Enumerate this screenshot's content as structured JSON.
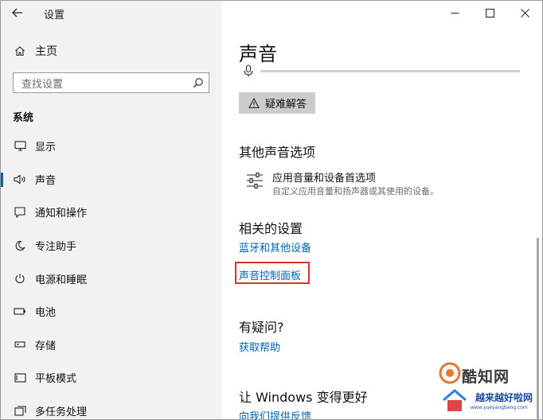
{
  "window": {
    "app_title": "设置",
    "controls": {
      "minimize": "—",
      "maximize": "☐",
      "close": "✕"
    }
  },
  "sidebar": {
    "back_label": "←",
    "home_label": "主页",
    "search_placeholder": "查找设置",
    "section_title": "系统",
    "items": [
      {
        "label": "显示",
        "icon": "monitor-icon"
      },
      {
        "label": "声音",
        "icon": "speaker-icon",
        "active": true
      },
      {
        "label": "通知和操作",
        "icon": "notification-icon"
      },
      {
        "label": "专注助手",
        "icon": "moon-icon"
      },
      {
        "label": "电源和睡眠",
        "icon": "power-icon"
      },
      {
        "label": "电池",
        "icon": "battery-icon"
      },
      {
        "label": "存储",
        "icon": "storage-icon"
      },
      {
        "label": "平板模式",
        "icon": "tablet-icon"
      },
      {
        "label": "多任务处理",
        "icon": "multitask-icon"
      }
    ]
  },
  "main": {
    "title": "声音",
    "troubleshoot_label": "疑难解答",
    "other_sound_options": {
      "header": "其他声音选项",
      "item_title": "应用音量和设备首选项",
      "item_desc": "自定义应用音量和扬声器或其使用的设备。"
    },
    "related_settings": {
      "header": "相关的设置",
      "links": [
        "蓝牙和其他设备",
        "声音控制面板"
      ]
    },
    "questions": {
      "header": "有疑问?",
      "link": "获取帮助"
    },
    "improve": {
      "header": "让 Windows 变得更好",
      "link": "向我们提供反馈"
    }
  },
  "watermark": {
    "brand": "酷知网",
    "site_name": "越来越好啦网",
    "url": "www.yueyangbang.com"
  },
  "colors": {
    "accent": "#0063b1",
    "highlight_border": "#d9332b",
    "sidebar_bg": "#f2f2f2",
    "button_bg": "#cccccc"
  }
}
